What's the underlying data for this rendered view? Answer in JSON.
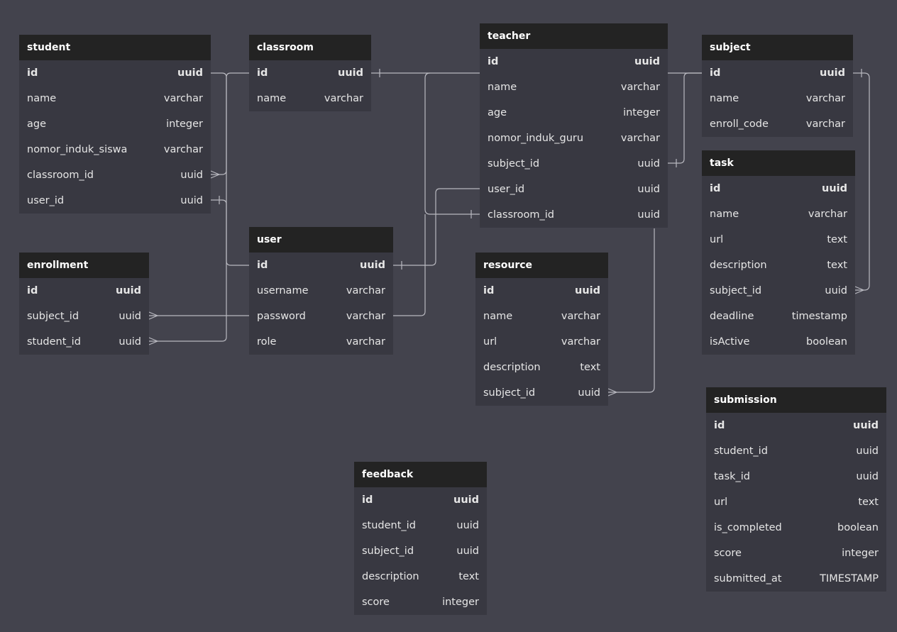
{
  "diagram": {
    "colors": {
      "background": "#43434d",
      "table_body": "#383841",
      "table_header": "#232323",
      "line": "#b9b9c0",
      "text": "#e6e6e6"
    },
    "tables": {
      "student": {
        "name": "student",
        "columns": [
          {
            "name": "id",
            "type": "uuid",
            "pk": true
          },
          {
            "name": "name",
            "type": "varchar"
          },
          {
            "name": "age",
            "type": "integer"
          },
          {
            "name": "nomor_induk_siswa",
            "type": "varchar"
          },
          {
            "name": "classroom_id",
            "type": "uuid"
          },
          {
            "name": "user_id",
            "type": "uuid"
          }
        ]
      },
      "classroom": {
        "name": "classroom",
        "columns": [
          {
            "name": "id",
            "type": "uuid",
            "pk": true
          },
          {
            "name": "name",
            "type": "varchar"
          }
        ]
      },
      "teacher": {
        "name": "teacher",
        "columns": [
          {
            "name": "id",
            "type": "uuid",
            "pk": true
          },
          {
            "name": "name",
            "type": "varchar"
          },
          {
            "name": "age",
            "type": "integer"
          },
          {
            "name": "nomor_induk_guru",
            "type": "varchar"
          },
          {
            "name": "subject_id",
            "type": "uuid"
          },
          {
            "name": "user_id",
            "type": "uuid"
          },
          {
            "name": "classroom_id",
            "type": "uuid"
          }
        ]
      },
      "subject": {
        "name": "subject",
        "columns": [
          {
            "name": "id",
            "type": "uuid",
            "pk": true
          },
          {
            "name": "name",
            "type": "varchar"
          },
          {
            "name": "enroll_code",
            "type": "varchar"
          }
        ]
      },
      "task": {
        "name": "task",
        "columns": [
          {
            "name": "id",
            "type": "uuid",
            "pk": true
          },
          {
            "name": "name",
            "type": "varchar"
          },
          {
            "name": "url",
            "type": "text"
          },
          {
            "name": "description",
            "type": "text"
          },
          {
            "name": "subject_id",
            "type": "uuid"
          },
          {
            "name": "deadline",
            "type": "timestamp"
          },
          {
            "name": "isActive",
            "type": "boolean"
          }
        ]
      },
      "user": {
        "name": "user",
        "columns": [
          {
            "name": "id",
            "type": "uuid",
            "pk": true
          },
          {
            "name": "username",
            "type": "varchar"
          },
          {
            "name": "password",
            "type": "varchar"
          },
          {
            "name": "role",
            "type": "varchar"
          }
        ]
      },
      "enrollment": {
        "name": "enrollment",
        "columns": [
          {
            "name": "id",
            "type": "uuid",
            "pk": true
          },
          {
            "name": "subject_id",
            "type": "uuid"
          },
          {
            "name": "student_id",
            "type": "uuid"
          }
        ]
      },
      "resource": {
        "name": "resource",
        "columns": [
          {
            "name": "id",
            "type": "uuid",
            "pk": true
          },
          {
            "name": "name",
            "type": "varchar"
          },
          {
            "name": "url",
            "type": "varchar"
          },
          {
            "name": "description",
            "type": "text"
          },
          {
            "name": "subject_id",
            "type": "uuid"
          }
        ]
      },
      "feedback": {
        "name": "feedback",
        "columns": [
          {
            "name": "id",
            "type": "uuid",
            "pk": true
          },
          {
            "name": "student_id",
            "type": "uuid"
          },
          {
            "name": "subject_id",
            "type": "uuid"
          },
          {
            "name": "description",
            "type": "text"
          },
          {
            "name": "score",
            "type": "integer"
          }
        ]
      },
      "submission": {
        "name": "submission",
        "columns": [
          {
            "name": "id",
            "type": "uuid",
            "pk": true
          },
          {
            "name": "student_id",
            "type": "uuid"
          },
          {
            "name": "task_id",
            "type": "uuid"
          },
          {
            "name": "url",
            "type": "text"
          },
          {
            "name": "is_completed",
            "type": "boolean"
          },
          {
            "name": "score",
            "type": "integer"
          },
          {
            "name": "submitted_at",
            "type": "TIMESTAMP"
          }
        ]
      }
    },
    "relationships": [
      {
        "from": "student.classroom_id",
        "to": "classroom.id",
        "cardinality": "many-to-one"
      },
      {
        "from": "student.user_id",
        "to": "user.id",
        "cardinality": "one-to-one"
      },
      {
        "from": "teacher.classroom_id",
        "to": "classroom.id",
        "cardinality": "one-to-one"
      },
      {
        "from": "teacher.user_id",
        "to": "user.id",
        "cardinality": "one-to-one"
      },
      {
        "from": "teacher.subject_id",
        "to": "subject.id",
        "cardinality": "one-to-one"
      },
      {
        "from": "task.subject_id",
        "to": "subject.id",
        "cardinality": "many-to-one"
      },
      {
        "from": "resource.subject_id",
        "to": "teacher.id",
        "cardinality": "many-to-one"
      },
      {
        "from": "enrollment.subject_id",
        "to": "user.password",
        "cardinality": "many-to-one"
      },
      {
        "from": "enrollment.student_id",
        "to": "student.id",
        "cardinality": "many-to-one"
      }
    ]
  }
}
